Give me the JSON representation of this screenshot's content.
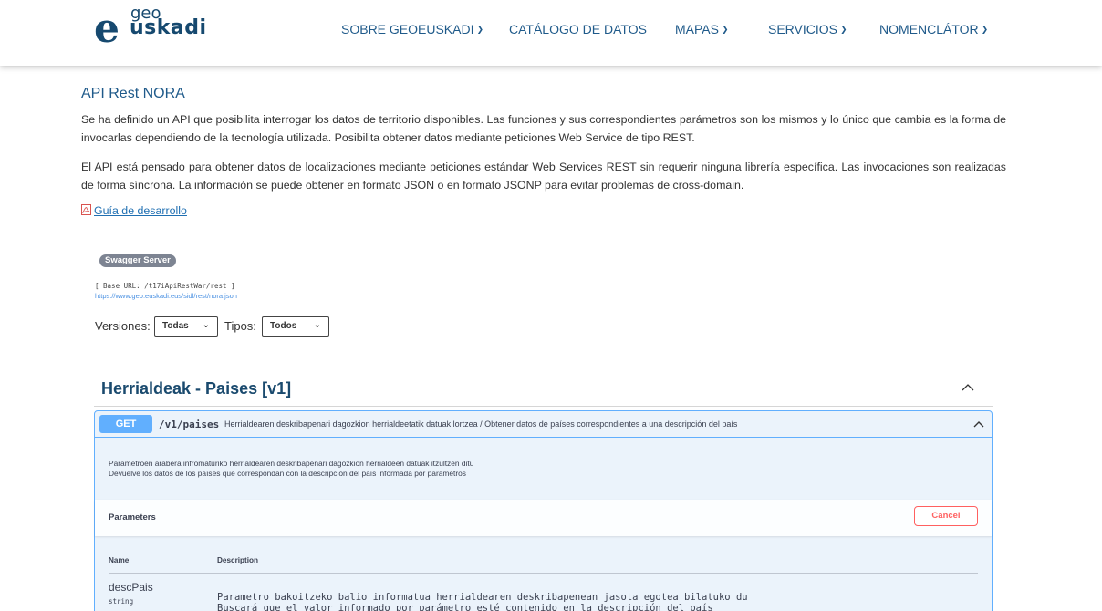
{
  "header": {
    "logo": {
      "e": "e",
      "geo": "geo",
      "uskadi": "uskadi"
    },
    "nav": [
      {
        "label": "SOBRE GEOEUSKADI",
        "dropdown": true
      },
      {
        "label": "CATÁLOGO DE DATOS",
        "dropdown": false
      },
      {
        "label": "MAPAS",
        "dropdown": true
      },
      {
        "label": "SERVICIOS",
        "dropdown": true
      },
      {
        "label": "NOMENCLÁTOR",
        "dropdown": true
      }
    ]
  },
  "content": {
    "title": "API Rest NORA",
    "paragraph1": "Se ha definido un API que posibilita interrogar los datos de territorio disponibles. Las funciones y sus correspondientes parámetros son los mismos y lo único que cambia es la forma de invocarlas dependiendo de la tecnología utilizada. Posibilita obtener datos mediante peticiones Web Service de tipo REST.",
    "paragraph2": "El API está pensado para obtener datos de localizaciones mediante peticiones estándar Web Services REST sin requerir ninguna librería específica. Las invocaciones son realizadas de forma síncrona. La información se puede obtener en formato JSON o en formato JSONP para evitar problemas de cross-domain.",
    "pdf_link": "Guía de desarrollo"
  },
  "swagger": {
    "badge": "Swagger Server",
    "base_url": "[ Base URL: /t17iApiRestWar/rest ]",
    "json_url": "https://www.geo.euskadi.eus/sidl/rest/nora.json",
    "versiones_label": "Versiones:",
    "versiones_value": "Todas",
    "tipos_label": "Tipos:",
    "tipos_value": "Todos",
    "tag_title": "Herrialdeak - Paises [v1]",
    "operation": {
      "method": "GET",
      "path": "/v1/paises",
      "summary": "Herrialdearen deskribapenari dagozkion herrialdeetatik datuak lortzea / Obtener datos de países correspondientes a una descripción del país",
      "description_eu": "Parametroen arabera infromaturiko herrialdearen deskribapenari dagozkion herrialdeen datuak itzultzen ditu",
      "description_es": "Devuelve los datos de los países que correspondan con la descripción del país informada por parámetros",
      "parameters_title": "Parameters",
      "cancel_label": "Cancel",
      "col_name": "Name",
      "col_description": "Description",
      "param": {
        "name": "descPais",
        "type": "string",
        "desc_eu": "Parametro bakoitzeko balio informatua herrialdearen deskribapenean jasota egotea bilatuko du",
        "desc_es": "Buscará que el valor informado por parámetro esté contenido en la descripción del país"
      }
    }
  },
  "colors": {
    "brand": "#16496f",
    "nav": "#1f5a8a",
    "get": "#61affe",
    "cancel": "#ff6060"
  }
}
